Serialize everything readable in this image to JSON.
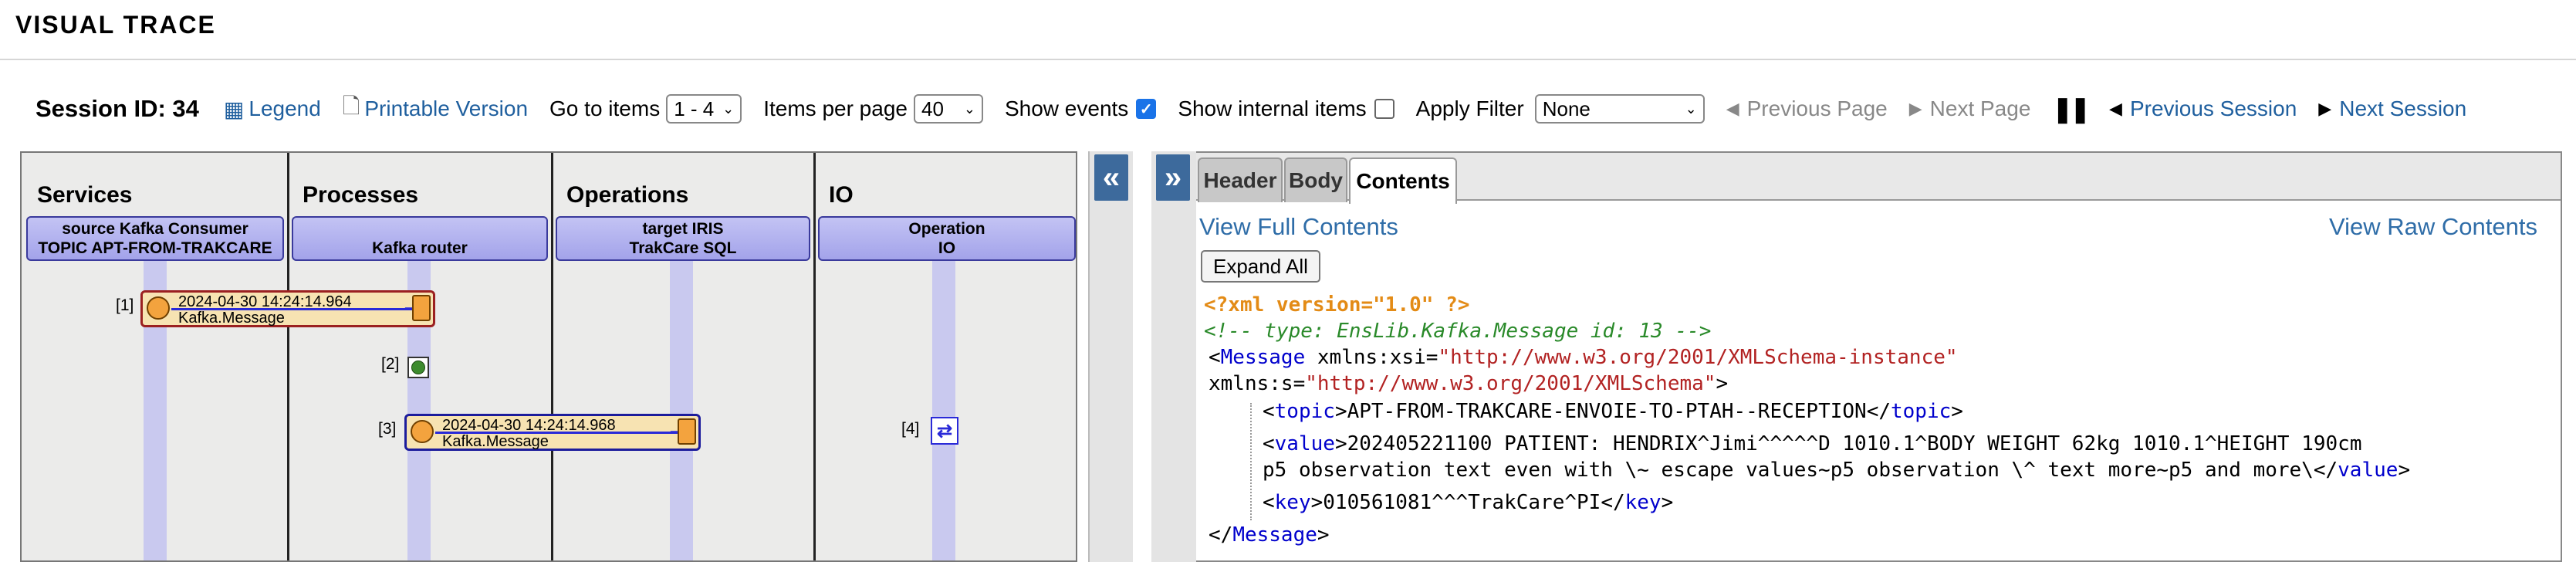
{
  "app": {
    "title": "VISUAL TRACE"
  },
  "toolbar": {
    "session_id": "Session ID: 34",
    "legend": "Legend",
    "printable": "Printable Version",
    "goto_label": "Go to items",
    "goto_value": "1 - 4",
    "per_page_label": "Items per page",
    "per_page_value": "40",
    "show_events_label": "Show events",
    "show_events_checked": true,
    "show_internal_label": "Show internal items",
    "show_internal_checked": false,
    "apply_filter_label": "Apply Filter",
    "filter_value": "None",
    "prev_page": "Previous Page",
    "next_page": "Next Page",
    "prev_session": "Previous Session",
    "next_session": "Next Session"
  },
  "trace": {
    "columns": [
      "Services",
      "Processes",
      "Operations",
      "IO"
    ],
    "hosts": [
      {
        "line1": "source Kafka Consumer",
        "line2": "TOPIC APT-FROM-TRAKCARE"
      },
      {
        "line1": "",
        "line2": "Kafka router"
      },
      {
        "line1": "target IRIS",
        "line2": "TrakCare SQL"
      },
      {
        "line1": "Operation",
        "line2": "IO"
      }
    ],
    "items": [
      {
        "index": "[1]",
        "time": "2024-04-30 14:24:14.964",
        "message": "Kafka.Message"
      },
      {
        "index": "[2]"
      },
      {
        "index": "[3]",
        "time": "2024-04-30 14:24:14.968",
        "message": "Kafka.Message"
      },
      {
        "index": "[4]"
      }
    ],
    "collapse_glyph": "«",
    "expand_glyph": "»"
  },
  "contents": {
    "tabs": [
      "Header",
      "Body",
      "Contents"
    ],
    "active_tab": "Contents",
    "view_full": "View Full Contents",
    "view_raw": "View Raw Contents",
    "expand_all": "Expand All",
    "xml": {
      "pi": "<?xml version=\"1.0\" ?>",
      "comment": "<!-- type: EnsLib.Kafka.Message  id: 13 -->",
      "message_tag": "Message",
      "xsi_attr": "xmlns:xsi",
      "xsi_val": "\"http://www.w3.org/2001/XMLSchema-instance\"",
      "s_attr": "xmlns:s",
      "s_val": "\"http://www.w3.org/2001/XMLSchema\"",
      "topic_tag": "topic",
      "topic_val": "APT-FROM-TRAKCARE-ENVOIE-TO-PTAH--RECEPTION",
      "value_tag": "value",
      "value_line1": "202405221100 PATIENT: HENDRIX^Jimi^^^^^D  1010.1^BODY WEIGHT 62kg  1010.1^HEIGHT 190cm",
      "value_line2": "p5 observation text even with \\~ escape values~p5 observation \\^ text more~p5 and more\\",
      "key_tag": "key",
      "key_val": "010561081^^^TrakCare^PI"
    }
  }
}
